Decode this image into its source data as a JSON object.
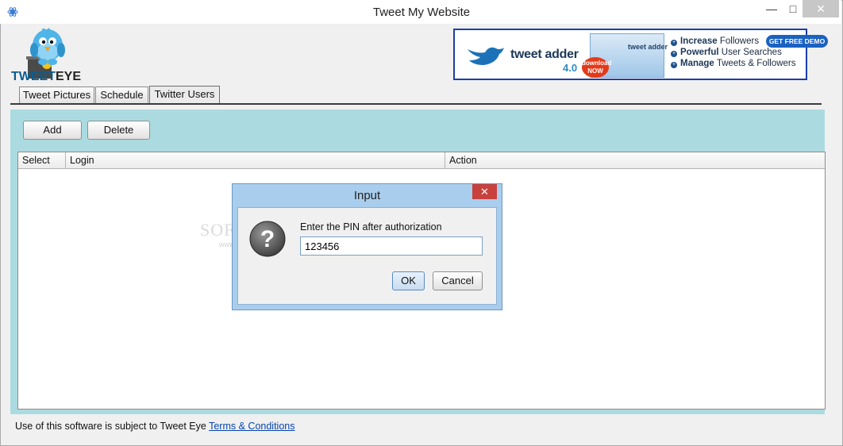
{
  "window": {
    "title": "Tweet My Website",
    "minimize_glyph": "—",
    "maximize_glyph": "□",
    "close_glyph": "✕"
  },
  "logo": {
    "text_prefix": "TWEET",
    "text_suffix": "EYE"
  },
  "banner": {
    "brand": "tweet adder",
    "version": "4.0",
    "badge": "download NOW",
    "box_label": "tweet adder",
    "bullets": [
      {
        "bold": "Increase",
        "rest": " Followers"
      },
      {
        "bold": "Powerful",
        "rest": " User Searches"
      },
      {
        "bold": "Manage",
        "rest": " Tweets & Followers"
      }
    ],
    "demo_button": "GET FREE DEMO"
  },
  "tabs": [
    {
      "label": "Tweet Pictures"
    },
    {
      "label": "Schedule"
    },
    {
      "label": "Twitter Users",
      "active": true
    }
  ],
  "toolbar": {
    "add_label": "Add",
    "delete_label": "Delete"
  },
  "table": {
    "columns": [
      "Select",
      "Login",
      "Action"
    ],
    "rows": []
  },
  "dialog": {
    "title": "Input",
    "close_glyph": "✕",
    "prompt": "Enter the PIN after authorization",
    "pin_value": "123456",
    "ok_label": "OK",
    "cancel_label": "Cancel"
  },
  "watermark": {
    "text": "SOFTPEDIA",
    "sub": "www.softpedia.com"
  },
  "footer": {
    "text": "Use of this software is subject to Tweet Eye ",
    "link": "Terms & Conditions"
  },
  "colors": {
    "panel_bg": "#abdbe0",
    "dialog_frame": "#a9cdec",
    "dialog_close": "#c8413d",
    "link": "#0645ad"
  }
}
